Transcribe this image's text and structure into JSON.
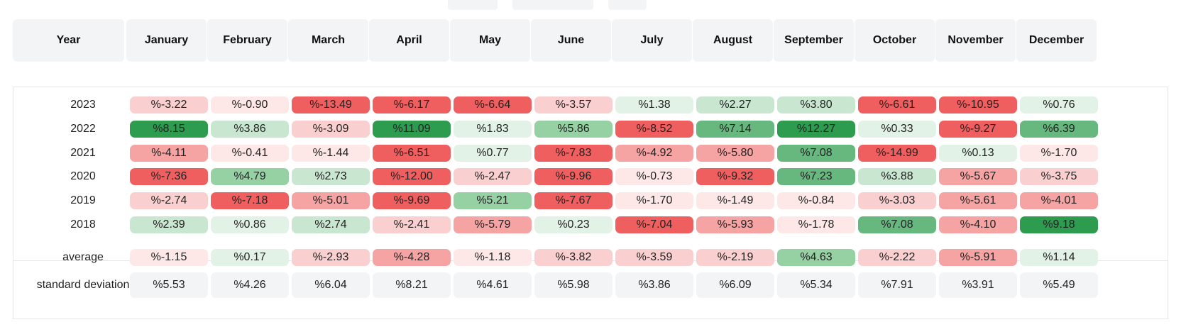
{
  "header": {
    "year_label": "Year",
    "months": [
      "January",
      "February",
      "March",
      "April",
      "May",
      "June",
      "July",
      "August",
      "September",
      "October",
      "November",
      "December"
    ]
  },
  "rows": [
    {
      "year": "2023",
      "values": [
        "%-3.22",
        "%-0.90",
        "%-13.49",
        "%-6.17",
        "%-6.64",
        "%-3.57",
        "%1.38",
        "%2.27",
        "%3.80",
        "%-6.61",
        "%-10.95",
        "%0.76"
      ]
    },
    {
      "year": "2022",
      "values": [
        "%8.15",
        "%3.86",
        "%-3.09",
        "%11.09",
        "%1.83",
        "%5.86",
        "%-8.52",
        "%7.14",
        "%12.27",
        "%0.33",
        "%-9.27",
        "%6.39"
      ]
    },
    {
      "year": "2021",
      "values": [
        "%-4.11",
        "%-0.41",
        "%-1.44",
        "%-6.51",
        "%0.77",
        "%-7.83",
        "%-4.92",
        "%-5.80",
        "%7.08",
        "%-14.99",
        "%0.13",
        "%-1.70"
      ]
    },
    {
      "year": "2020",
      "values": [
        "%-7.36",
        "%4.79",
        "%2.73",
        "%-12.00",
        "%-2.47",
        "%-9.96",
        "%-0.73",
        "%-9.32",
        "%7.23",
        "%3.88",
        "%-5.67",
        "%-3.75"
      ]
    },
    {
      "year": "2019",
      "values": [
        "%-2.74",
        "%-7.18",
        "%-5.01",
        "%-9.69",
        "%5.21",
        "%-7.67",
        "%-1.70",
        "%-1.49",
        "%-0.84",
        "%-3.03",
        "%-5.61",
        "%-4.01"
      ]
    },
    {
      "year": "2018",
      "values": [
        "%2.39",
        "%0.86",
        "%2.74",
        "%-2.41",
        "%-5.79",
        "%0.23",
        "%-7.04",
        "%-5.93",
        "%-1.78",
        "%7.08",
        "%-4.10",
        "%9.18"
      ]
    }
  ],
  "average": {
    "label": "average",
    "values": [
      "%-1.15",
      "%0.17",
      "%-2.93",
      "%-4.28",
      "%-1.18",
      "%-3.82",
      "%-3.59",
      "%-2.19",
      "%4.63",
      "%-2.22",
      "%-5.91",
      "%1.14"
    ]
  },
  "std_dev": {
    "label": "standard deviation",
    "values": [
      "%5.53",
      "%4.26",
      "%6.04",
      "%8.21",
      "%4.61",
      "%5.98",
      "%3.86",
      "%6.09",
      "%5.34",
      "%7.91",
      "%3.91",
      "%5.49"
    ]
  },
  "colors": {
    "header_bg": "#f3f4f6",
    "panel_border": "#e6e7ea",
    "negative_scale": [
      "#fde7e7",
      "#f9cfcf",
      "#f5a3a3",
      "#ef5f5f"
    ],
    "positive_scale": [
      "#e3f2e6",
      "#c9e7d0",
      "#96d1a4",
      "#66b87e",
      "#2e9c4f"
    ]
  }
}
